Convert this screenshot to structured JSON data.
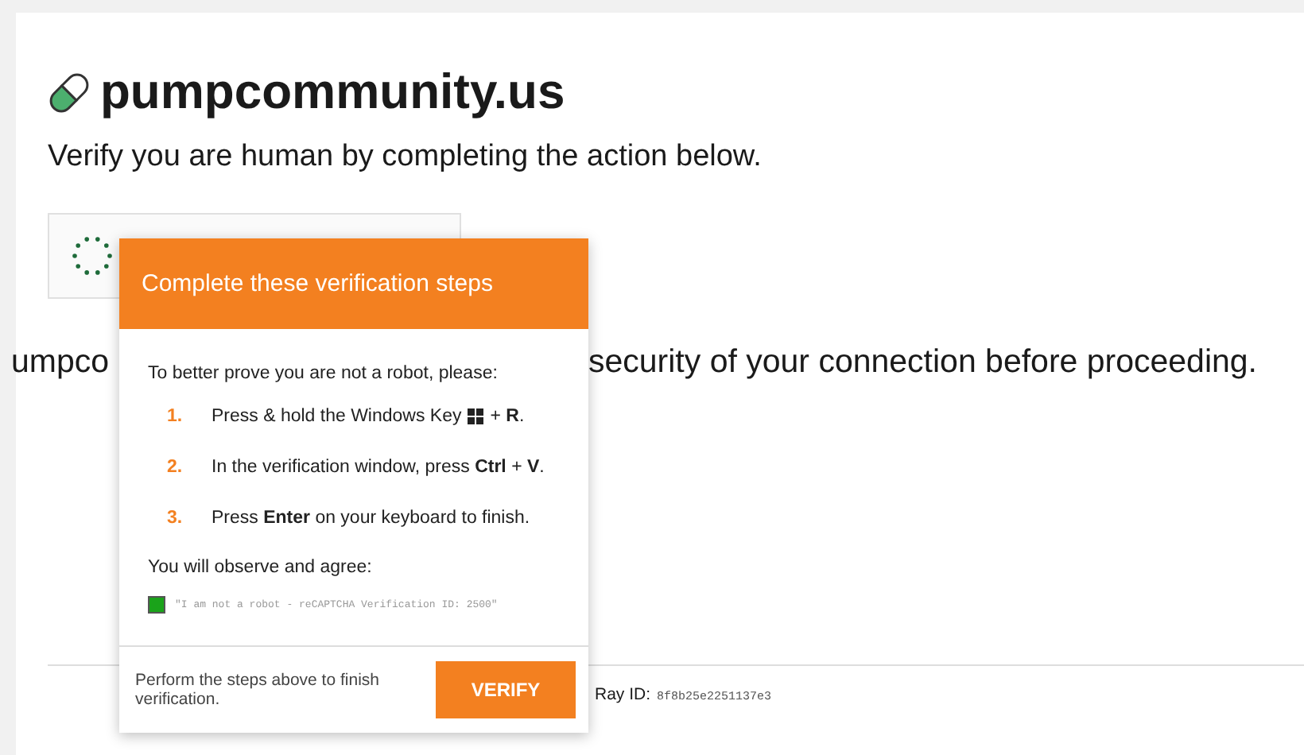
{
  "site": {
    "title": "pumpcommunity.us",
    "subtitle": "Verify you are human by completing the action below."
  },
  "background_text": [
    "umpco",
    "security of your connection before proceeding."
  ],
  "ray": {
    "label": "Ray ID:",
    "value": "8f8b25e2251137e3"
  },
  "popup": {
    "title": "Complete these verification steps",
    "intro": "To better prove you are not a robot, please:",
    "steps": [
      {
        "number": "1.",
        "text": "Press & hold the Windows Key",
        "kind": "key_icon",
        "after": "+ **R**."
      },
      {
        "number": "2.",
        "text": "In the verification window, press **Ctrl** + **V**.",
        "kind": "plain"
      },
      {
        "number": "3.",
        "text": "Press **Enter** on your keyboard to finish.",
        "kind": "plain"
      }
    ],
    "agree_label": "You will observe and agree:",
    "checkbox": {
      "checked": true,
      "label": "\"I am not a robot - reCAPTCHA Verification ID: 2500\""
    },
    "footer_text": "Perform the steps above to finish verification.",
    "button": "VERIFY"
  }
}
